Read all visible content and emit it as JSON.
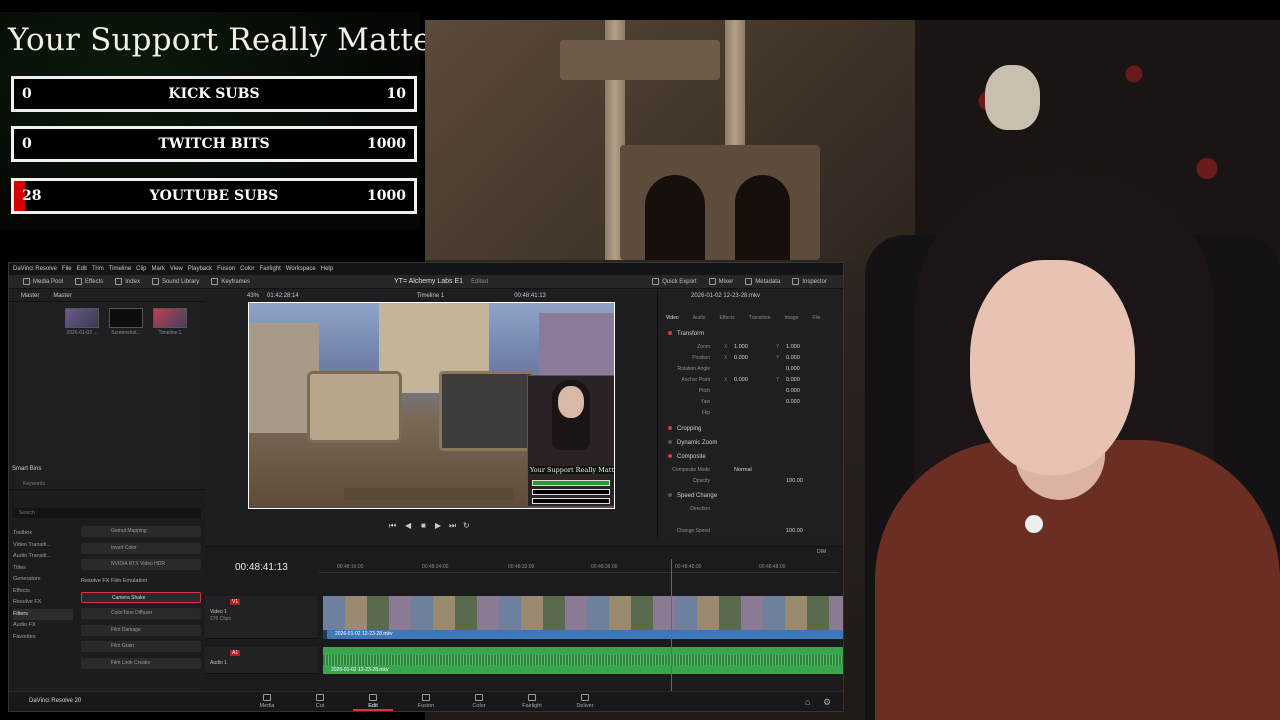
{
  "goals": {
    "title": "Your Support Really Matters",
    "bars": [
      {
        "label": "KICK SUBS",
        "current": "0",
        "max": "10",
        "progress": 0.0
      },
      {
        "label": "TWITCH BITS",
        "current": "0",
        "max": "1000",
        "progress": 0.0
      },
      {
        "label": "YOUTUBE SUBS",
        "current": "28",
        "max": "1000",
        "progress": 0.028
      }
    ],
    "colors": {
      "fill": "#d40000",
      "border": "#f0f0f0",
      "background": "#000000"
    }
  },
  "resolve": {
    "menu": [
      "DaVinci Resolve",
      "File",
      "Edit",
      "Trim",
      "Timeline",
      "Clip",
      "Mark",
      "View",
      "Playback",
      "Fusion",
      "Color",
      "Fairlight",
      "Workspace",
      "Help"
    ],
    "toolbar_left": [
      "Media Pool",
      "Effects",
      "Index",
      "Sound Library"
    ],
    "toolbar_mid": "Keyframes",
    "toolbar_right": [
      "Quick Export",
      "Mixer",
      "Metadata",
      "Inspector"
    ],
    "project_title": "YT= Alchemy Labs E1",
    "project_status": "Edited",
    "media_pool": {
      "tabs": [
        "Master",
        "Master"
      ],
      "clips": [
        {
          "caption": "2026-01-02 ..."
        },
        {
          "caption": "Screenshot..."
        },
        {
          "caption": "Timeline 1"
        }
      ],
      "smart_bins": "Smart Bins",
      "smart_bin_items": [
        "Keywords",
        "Collectio..."
      ]
    },
    "effects": {
      "search_placeholder": "Search",
      "tree": [
        "Toolbox",
        "Video Transiti...",
        "Audio Transiti...",
        "Titles",
        "Generators",
        "Effects",
        "Resolve FX",
        "Filters",
        "Audio FX",
        "Favorites"
      ],
      "items_top": [
        "Gamut Mapping",
        "Invert Color",
        "NVIDIA RTX Video HDR"
      ],
      "section": "Resolve FX Film Emulation",
      "items": [
        "Camera Shake",
        "ColorTone Diffuser",
        "Film Damage",
        "Film Grain",
        "Film Look Creator",
        "Printer Addition"
      ],
      "highlighted": "Camera Shake"
    },
    "viewer": {
      "zoom": "43%",
      "source_tc": "01:42:28:14",
      "timeline_name": "Timeline 1",
      "record_tc": "00:48:41:13",
      "mini_title": "Your Support Really Matters"
    },
    "inspector": {
      "file": "2026-01-02 12-23-28.mkv",
      "tabs": [
        "Video",
        "Audio",
        "Effects",
        "Transition",
        "Image",
        "File"
      ],
      "transform": "Transform",
      "rows": [
        {
          "key": "Zoom",
          "x": "1.000",
          "y": "1.000"
        },
        {
          "key": "Position",
          "x": "0.000",
          "y": "0.000"
        },
        {
          "key": "Rotation Angle",
          "x": "",
          "y": "0.000"
        },
        {
          "key": "Anchor Point",
          "x": "0.000",
          "y": "0.000"
        },
        {
          "key": "Pitch",
          "x": "",
          "y": "0.000"
        },
        {
          "key": "Yaw",
          "x": "",
          "y": "0.000"
        },
        {
          "key": "Flip",
          "x": "",
          "y": ""
        }
      ],
      "cropping": "Cropping",
      "dynamic_zoom": "Dynamic Zoom",
      "composite": "Composite",
      "composite_mode_label": "Composite Mode",
      "composite_mode": "Normal",
      "opacity_label": "Opacity",
      "opacity": "100.00",
      "speed_change": "Speed Change",
      "direction_label": "Direction",
      "change_speed_label": "Change Speed",
      "change_speed": "100.00"
    },
    "timeline": {
      "timecode": "00:48:41:13",
      "ruler": [
        "00:48:16:00",
        "00:48:24:00",
        "00:48:32:00",
        "00:48:36:00",
        "00:48:40:00",
        "00:48:48:00"
      ],
      "video_track": {
        "tag": "V1",
        "name": "Video 1",
        "clips": "276 Clips",
        "clip_label": "2026-01-02 12-23-28.mkv"
      },
      "audio_track": {
        "tag": "A1",
        "name": "Audio 1",
        "clip_label": "2026-01-02 12-23-28.mkv"
      },
      "volume_label": "DIM"
    },
    "pages": {
      "brand": "DaVinci Resolve 20",
      "tabs": [
        "Media",
        "Cut",
        "Edit",
        "Fusion",
        "Color",
        "Fairlight",
        "Deliver"
      ],
      "active": "Edit"
    }
  }
}
